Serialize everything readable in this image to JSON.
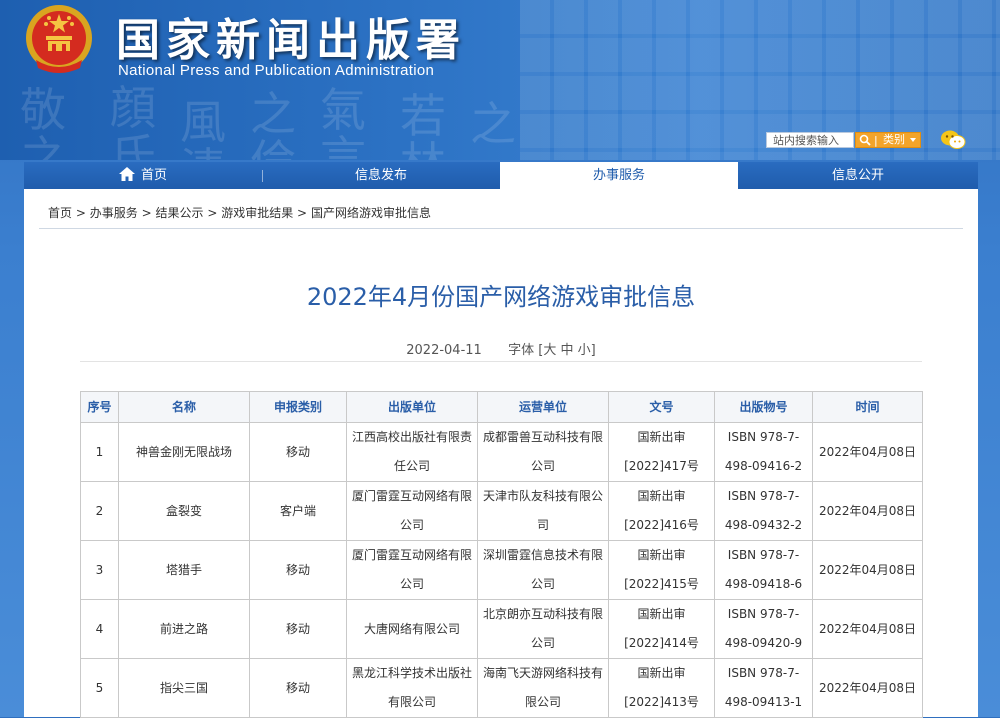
{
  "header": {
    "site_title": "国家新闻出版署",
    "site_subtitle": "National Press and Publication Administration",
    "search_placeholder": "站内搜索输入",
    "category_label": "类别",
    "emblem_icon": "national-emblem-icon",
    "wechat_icon": "wechat-icon"
  },
  "nav": {
    "items": [
      {
        "label": "首页",
        "icon": "home-icon"
      },
      {
        "label": "信息发布"
      },
      {
        "label": "办事服务",
        "active": true
      },
      {
        "label": "信息公开"
      }
    ]
  },
  "breadcrumb": [
    "首页",
    "办事服务",
    "结果公示",
    "游戏审批结果",
    "国产网络游戏审批信息"
  ],
  "breadcrumb_separator": ">",
  "article": {
    "title": "2022年4月份国产网络游戏审批信息",
    "date": "2022-04-11",
    "font_label": "字体",
    "font_sizes": [
      "大",
      "中",
      "小"
    ]
  },
  "table": {
    "headers": [
      "序号",
      "名称",
      "申报类别",
      "出版单位",
      "运营单位",
      "文号",
      "出版物号",
      "时间"
    ],
    "rows": [
      [
        "1",
        "神兽金刚无限战场",
        "移动",
        "江西高校出版社有限责任公司",
        "成都雷兽互动科技有限公司",
        "国新出审[2022]417号",
        "ISBN 978-7-498-09416-2",
        "2022年04月08日"
      ],
      [
        "2",
        "盒裂变",
        "客户端",
        "厦门雷霆互动网络有限公司",
        "天津市队友科技有限公司",
        "国新出审[2022]416号",
        "ISBN 978-7-498-09432-2",
        "2022年04月08日"
      ],
      [
        "3",
        "塔猎手",
        "移动",
        "厦门雷霆互动网络有限公司",
        "深圳雷霆信息技术有限公司",
        "国新出审[2022]415号",
        "ISBN 978-7-498-09418-6",
        "2022年04月08日"
      ],
      [
        "4",
        "前进之路",
        "移动",
        "大唐网络有限公司",
        "北京朗亦互动科技有限公司",
        "国新出审[2022]414号",
        "ISBN 978-7-498-09420-9",
        "2022年04月08日"
      ],
      [
        "5",
        "指尖三国",
        "移动",
        "黑龙江科学技术出版社有限公司",
        "海南飞天游网络科技有限公司",
        "国新出审[2022]413号",
        "ISBN 978-7-498-09413-1",
        "2022年04月08日"
      ]
    ]
  },
  "colors": {
    "brand_blue": "#1f5cac",
    "title_blue": "#2a5ea8",
    "search_orange": "#f3a42a"
  }
}
